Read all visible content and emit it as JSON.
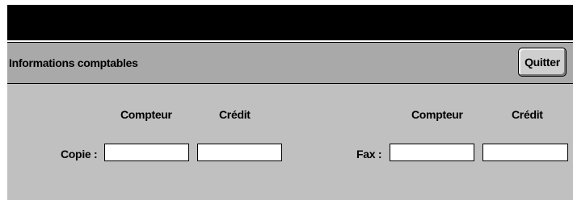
{
  "header": {
    "title": "Informations comptables",
    "quit_label": "Quitter"
  },
  "copy": {
    "label": "Copie :",
    "counter_header": "Compteur",
    "credit_header": "Crédit",
    "counter_value": "",
    "credit_value": ""
  },
  "fax": {
    "label": "Fax :",
    "counter_header": "Compteur",
    "credit_header": "Crédit",
    "counter_value": "",
    "credit_value": ""
  }
}
